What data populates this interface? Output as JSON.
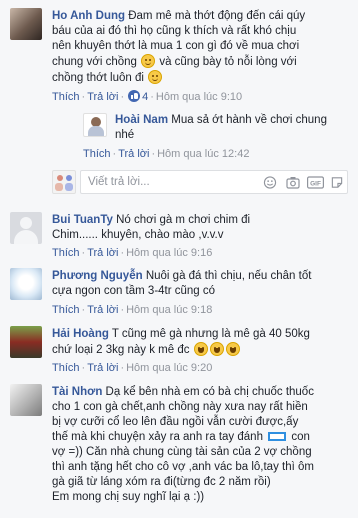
{
  "comments": [
    {
      "name": "Ho Anh Dung",
      "text_l1": "Đam mê mà thớt động đến cái qúy",
      "text_l2": "báu của ai đó thì họ cũng k thích và rất khó chịu",
      "text_l3": "nên khuyên thớt là mua 1 con gì đó về mua chơi",
      "text_l4": "chung với chồng",
      "text_l4b": "và cũng bày tỏ nỗi lòng với",
      "text_l5": "chồng thớt luôn đi",
      "like": "Thích",
      "reply": "Trả lời",
      "likes": "4",
      "time": "Hôm qua lúc 9:10"
    },
    {
      "name": "Hoài Nam",
      "text_l1": "Mua sả ớt hành về chơi chung",
      "text_l2": "nhé",
      "like": "Thích",
      "reply": "Trả lời",
      "time": "Hôm qua lúc 12:42"
    },
    {
      "name": "Bui TuanTy",
      "text_l1": "Nó chơi gà m chơi chim đi",
      "text_l2": "Chim...... khuyên, chào mào ,v.v.v",
      "like": "Thích",
      "reply": "Trả lời",
      "time": "Hôm qua lúc 9:16"
    },
    {
      "name": "Phương Nguyễn",
      "text_l1": "Nuôi gà đá thì chịu, nếu chân tốt",
      "text_l2": "cựa ngon con tầm 3-4tr cũng có",
      "like": "Thích",
      "reply": "Trả lời",
      "time": "Hôm qua lúc 9:18"
    },
    {
      "name": "Hải Hoàng",
      "text_l1": "T cũng mê gà nhưng là mê gà 40 50kg",
      "text_l2": "chứ loại 2 3kg này k mê đc",
      "like": "Thích",
      "reply": "Trả lời",
      "time": "Hôm qua lúc 9:20"
    },
    {
      "name": "Tài Nhơn",
      "text_l1": "Dạ kể bên nhà em có bà chị chuốc thuốc",
      "text_l2": "cho 1 con gà chết,anh chồng này xưa nay rất hiền",
      "text_l3": "bị vợ cưỡi cổ leo lên đầu ngồi vẫn cười được,ấy",
      "text_l4": "thế mà khi chuyện xảy ra anh ra tay đánh",
      "text_l4b": "con",
      "text_l5": "vợ =)) Căn nhà chung cùng tài sản của 2 vợ chồng",
      "text_l6": "thì anh tặng hết cho cô vợ ,anh vác ba lô,tay thì ôm",
      "text_l7": "gà giã từ láng xóm ra đi(từng đc 2 năm rồi)",
      "text_l8": "Em mong chị suy nghĩ lại ạ :))"
    }
  ],
  "reply_box": {
    "placeholder": "Viết trả lời..."
  },
  "icons": [
    "emoji-icon",
    "camera-icon",
    "gif-icon",
    "sticker-icon"
  ],
  "colors": {
    "link": "#365899",
    "like": "#4267b2",
    "meta": "#90949c"
  }
}
